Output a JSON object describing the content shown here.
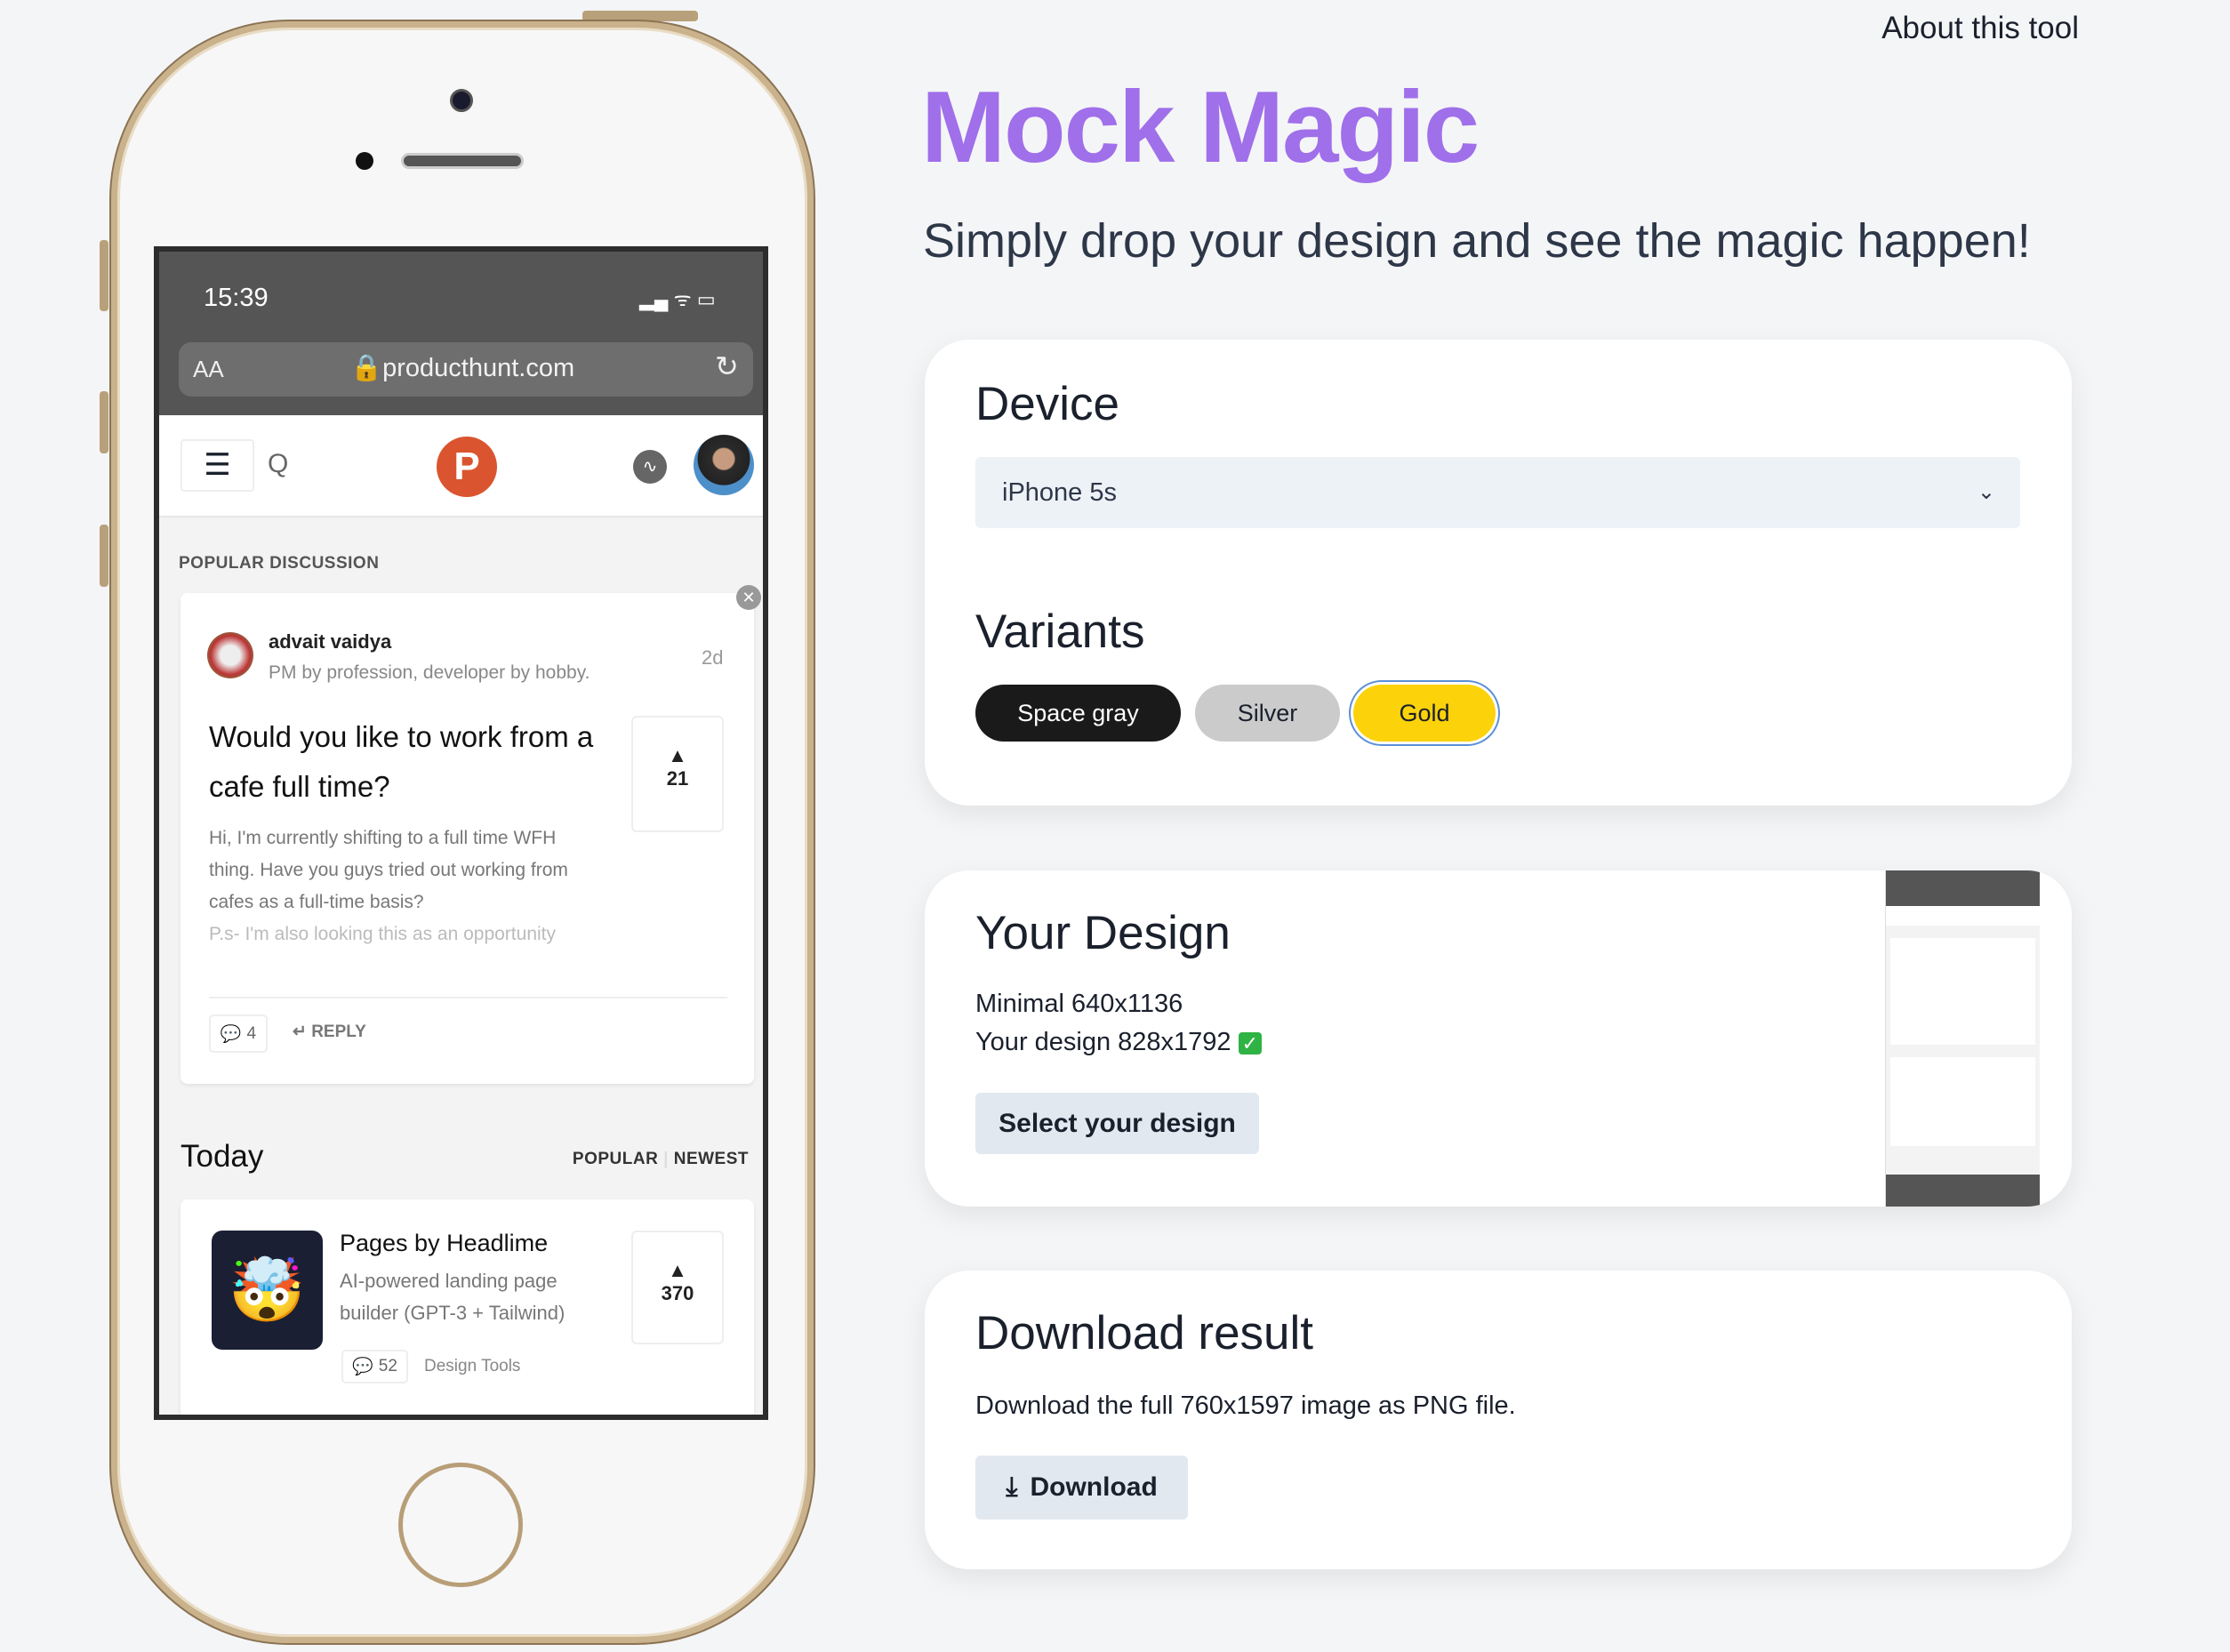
{
  "header": {
    "about_link": "About this tool",
    "title": "Mock Magic",
    "subtitle": "Simply drop your design and see the magic happen!",
    "title_color": "#a06fea"
  },
  "device_card": {
    "title": "Device",
    "selected_device": "iPhone 5s",
    "variants_title": "Variants",
    "variants": [
      {
        "label": "Space gray",
        "selected": false
      },
      {
        "label": "Silver",
        "selected": false
      },
      {
        "label": "Gold",
        "selected": true
      }
    ]
  },
  "design_card": {
    "title": "Your Design",
    "minimal": "Minimal 640x1136",
    "yours": "Your design 828x1792",
    "check_icon": "check-mark",
    "button": "Select your design"
  },
  "download_card": {
    "title": "Download result",
    "text": "Download the full 760x1597 image as PNG file.",
    "button": "Download",
    "icon": "download-icon"
  },
  "phone": {
    "variant": "Gold",
    "status_time": "15:39",
    "url_size_label": "AA",
    "url": "producthunt.com",
    "logo_letter": "P",
    "section_label": "POPULAR DISCUSSION",
    "discussion": {
      "author": "advait vaidya",
      "tagline": "PM by profession, developer by hobby.",
      "age": "2d",
      "title": "Would you like to work from a cafe full time?",
      "votes": "21",
      "body": [
        "Hi, I'm currently shifting to a full time WFH",
        "thing. Have you guys tried out working from",
        "cafes as a full-time basis?",
        "P.s- I'm also looking this as an opportunity"
      ],
      "comments": "4",
      "reply": "REPLY"
    },
    "today": {
      "title": "Today",
      "tabs": [
        "POPULAR",
        "NEWEST"
      ]
    },
    "product": {
      "name": "Pages by Headlime",
      "desc": [
        "AI-powered landing page",
        "builder (GPT-3 + Tailwind)"
      ],
      "comments": "52",
      "topic": "Design Tools",
      "votes": "370",
      "emoji": "🤯"
    }
  }
}
